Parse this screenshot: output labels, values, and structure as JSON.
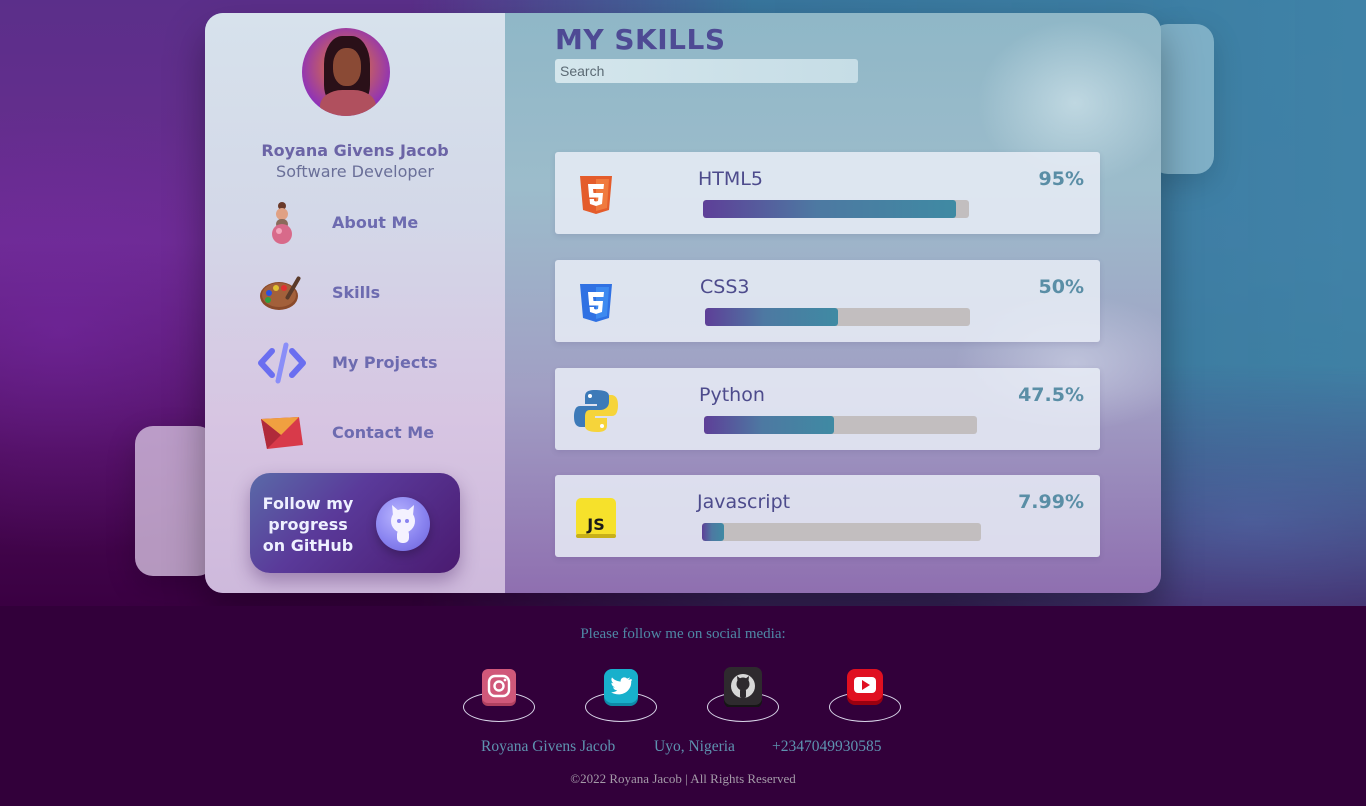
{
  "profile": {
    "name": "Royana Givens Jacob",
    "role": "Software Developer"
  },
  "nav": {
    "items": [
      {
        "label": "About Me",
        "icon": "person-3d-icon"
      },
      {
        "label": "Skills",
        "icon": "paint-palette-icon"
      },
      {
        "label": "My Projects",
        "icon": "code-brackets-icon"
      },
      {
        "label": "Contact Me",
        "icon": "envelope-icon"
      }
    ]
  },
  "github_cta": {
    "text": "Follow my progress on GitHub",
    "icon": "github-octocat-icon"
  },
  "main": {
    "title": "MY SKILLS",
    "search_placeholder": "Search"
  },
  "skills": [
    {
      "name": "HTML5",
      "percent_label": "95%",
      "progress": 0.95,
      "icon": "html5-icon",
      "color": "#e45c2b"
    },
    {
      "name": "CSS3",
      "percent_label": "50%",
      "progress": 0.5,
      "icon": "css3-icon",
      "color": "#2f71e3"
    },
    {
      "name": "Python",
      "percent_label": "47.5%",
      "progress": 0.475,
      "icon": "python-icon",
      "color": "#3d7ab8"
    },
    {
      "name": "Javascript",
      "percent_label": "7.99%",
      "progress": 0.0799,
      "icon": "javascript-icon",
      "color": "#f6e12b"
    }
  ],
  "footer": {
    "follow_text": "Please follow me on social media:",
    "social": [
      {
        "icon": "instagram-icon"
      },
      {
        "icon": "twitter-icon"
      },
      {
        "icon": "github-icon"
      },
      {
        "icon": "youtube-icon"
      }
    ],
    "contact": {
      "name": "Royana Givens Jacob",
      "location": "Uyo, Nigeria",
      "phone": "+2347049930585"
    },
    "copyright": "©2022 Royana Jacob | All Rights Reserved"
  },
  "colors": {
    "accent": "#4e4a94",
    "progress_start": "#5e3f98",
    "progress_end": "#3f8aa3",
    "footer_bg": "#32003a"
  }
}
